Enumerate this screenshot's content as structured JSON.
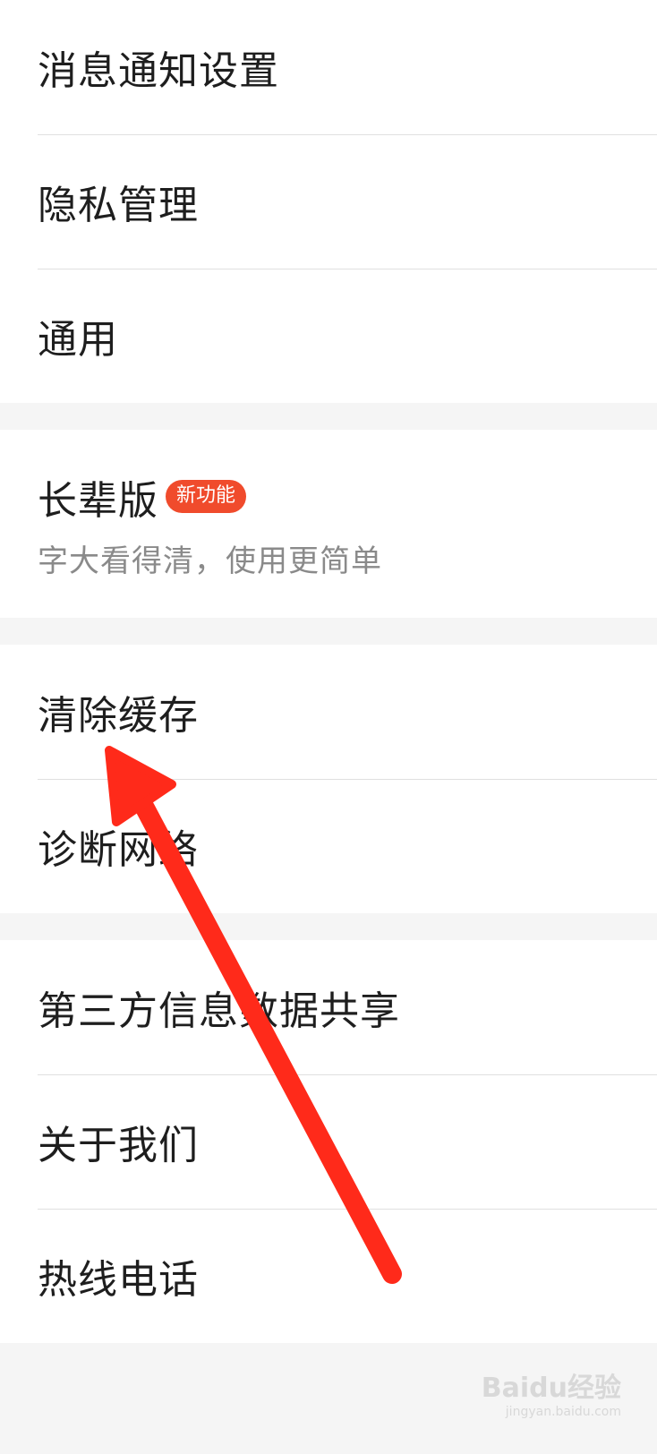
{
  "settings": {
    "group1": [
      {
        "label": "消息通知设置"
      },
      {
        "label": "隐私管理"
      },
      {
        "label": "通用"
      }
    ],
    "elder_mode": {
      "label": "长辈版",
      "badge": "新功能",
      "sublabel": "字大看得清，使用更简单"
    },
    "group3": [
      {
        "label": "清除缓存"
      },
      {
        "label": "诊断网络"
      }
    ],
    "group4": [
      {
        "label": "第三方信息数据共享"
      },
      {
        "label": "关于我们"
      },
      {
        "label": "热线电话"
      }
    ]
  },
  "colors": {
    "badge_bg": "#f04b2c",
    "arrow": "#ff2a1a",
    "background": "#f5f5f5"
  },
  "watermark": {
    "brand": "Baidu经验",
    "url": "jingyan.baidu.com"
  }
}
